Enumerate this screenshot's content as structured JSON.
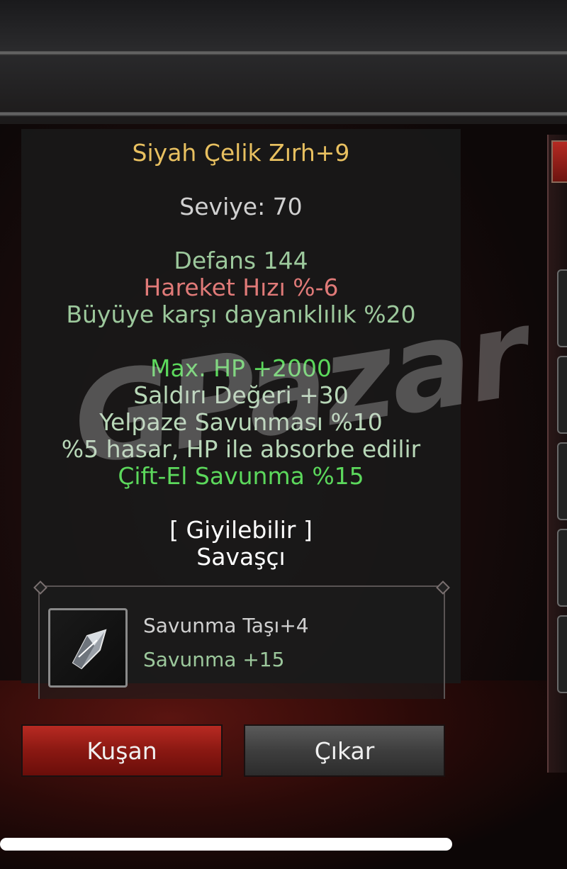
{
  "tooltip": {
    "item_name": "Siyah Çelik Zırh+9",
    "level": "Seviye: 70",
    "defense": "Defans 144",
    "move_speed": "Hareket Hızı %-6",
    "magic_resistance": "Büyüye karşı dayanıklılık %20",
    "bonuses": [
      "Max. HP +2000",
      "Saldırı Değeri +30",
      "Yelpaze Savunması %10",
      "%5 hasar, HP ile absorbe edilir",
      "Çift-El Savunma %15"
    ],
    "wearable": "[ Giyilebilir ]",
    "class": "Savaşçı"
  },
  "socket": {
    "gem_name": "Savunma Taşı+4",
    "gem_stat": "Savunma +15",
    "gem_icon": "gem-icon"
  },
  "buttons": {
    "equip": "Kuşan",
    "remove": "Çıkar"
  },
  "watermark": "GPazar",
  "colors": {
    "item_name": "#e8c060",
    "negative_stat": "#e07a78",
    "base_stat": "#9cc89c",
    "bonus_highlight": "#5cd85c",
    "equip_button": "#8a1812",
    "remove_button": "#3e3e3e"
  }
}
